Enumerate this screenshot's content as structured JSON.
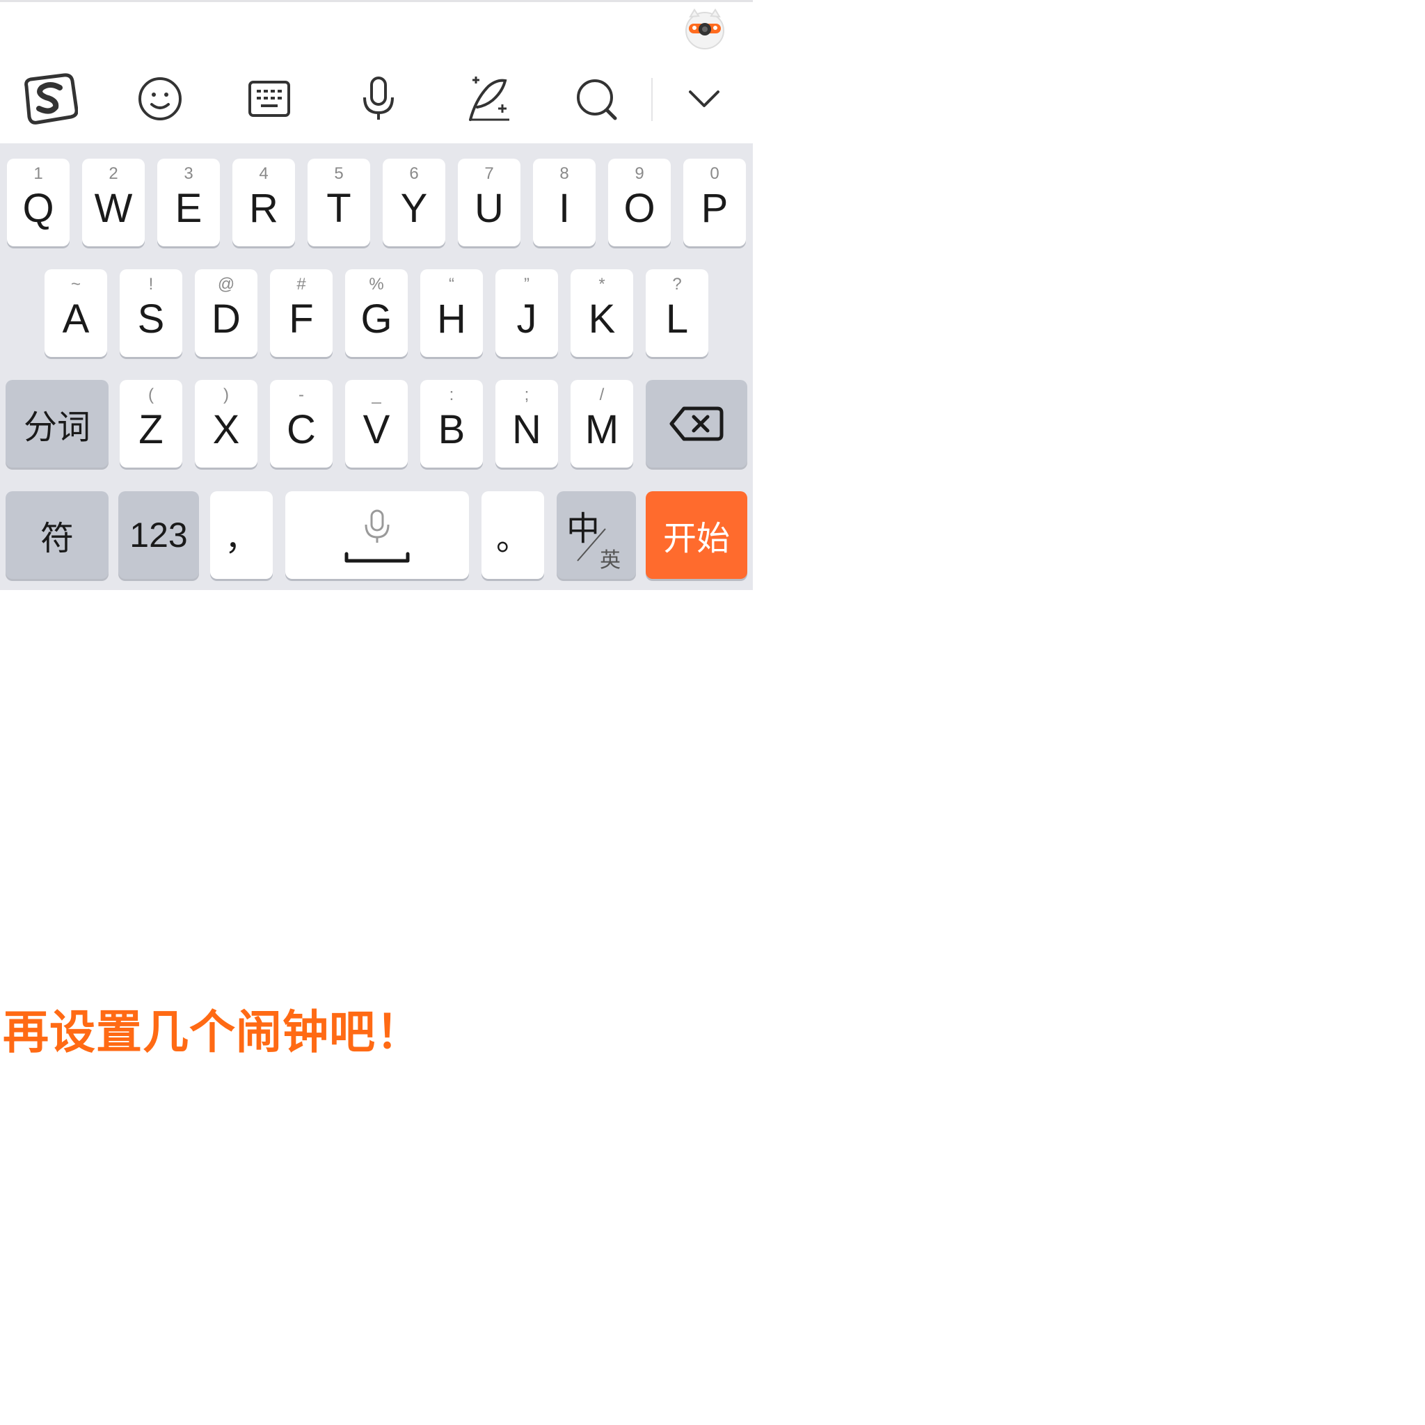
{
  "toolbar": {
    "icons": [
      "sogou-logo-icon",
      "emoji-icon",
      "keyboard-layout-icon",
      "microphone-icon",
      "handwriting-icon",
      "search-icon",
      "collapse-chevron-icon"
    ]
  },
  "keyboard": {
    "row1": [
      {
        "main": "Q",
        "sub": "1"
      },
      {
        "main": "W",
        "sub": "2"
      },
      {
        "main": "E",
        "sub": "3"
      },
      {
        "main": "R",
        "sub": "4"
      },
      {
        "main": "T",
        "sub": "5"
      },
      {
        "main": "Y",
        "sub": "6"
      },
      {
        "main": "U",
        "sub": "7"
      },
      {
        "main": "I",
        "sub": "8"
      },
      {
        "main": "O",
        "sub": "9"
      },
      {
        "main": "P",
        "sub": "0"
      }
    ],
    "row2": [
      {
        "main": "A",
        "sub": "~"
      },
      {
        "main": "S",
        "sub": "!"
      },
      {
        "main": "D",
        "sub": "@"
      },
      {
        "main": "F",
        "sub": "#"
      },
      {
        "main": "G",
        "sub": "%"
      },
      {
        "main": "H",
        "sub": "“"
      },
      {
        "main": "J",
        "sub": "”"
      },
      {
        "main": "K",
        "sub": "*"
      },
      {
        "main": "L",
        "sub": "?"
      }
    ],
    "row3": [
      {
        "main": "Z",
        "sub": "("
      },
      {
        "main": "X",
        "sub": ")"
      },
      {
        "main": "C",
        "sub": "-"
      },
      {
        "main": "V",
        "sub": "_"
      },
      {
        "main": "B",
        "sub": ":"
      },
      {
        "main": "N",
        "sub": ";"
      },
      {
        "main": "M",
        "sub": "/"
      }
    ],
    "segment_label": "分词",
    "symbols_label": "符",
    "numbers_label": "123",
    "comma_label": "，",
    "period_label": "。",
    "lang_main": "中",
    "lang_sub": "英",
    "start_label": "开始"
  },
  "caption": "再设置几个闹钟吧！",
  "colors": {
    "accent": "#ff6b2d",
    "caption": "#ff6a14",
    "function_key": "#c3c7d0",
    "keyboard_bg": "#e6e7ec"
  }
}
